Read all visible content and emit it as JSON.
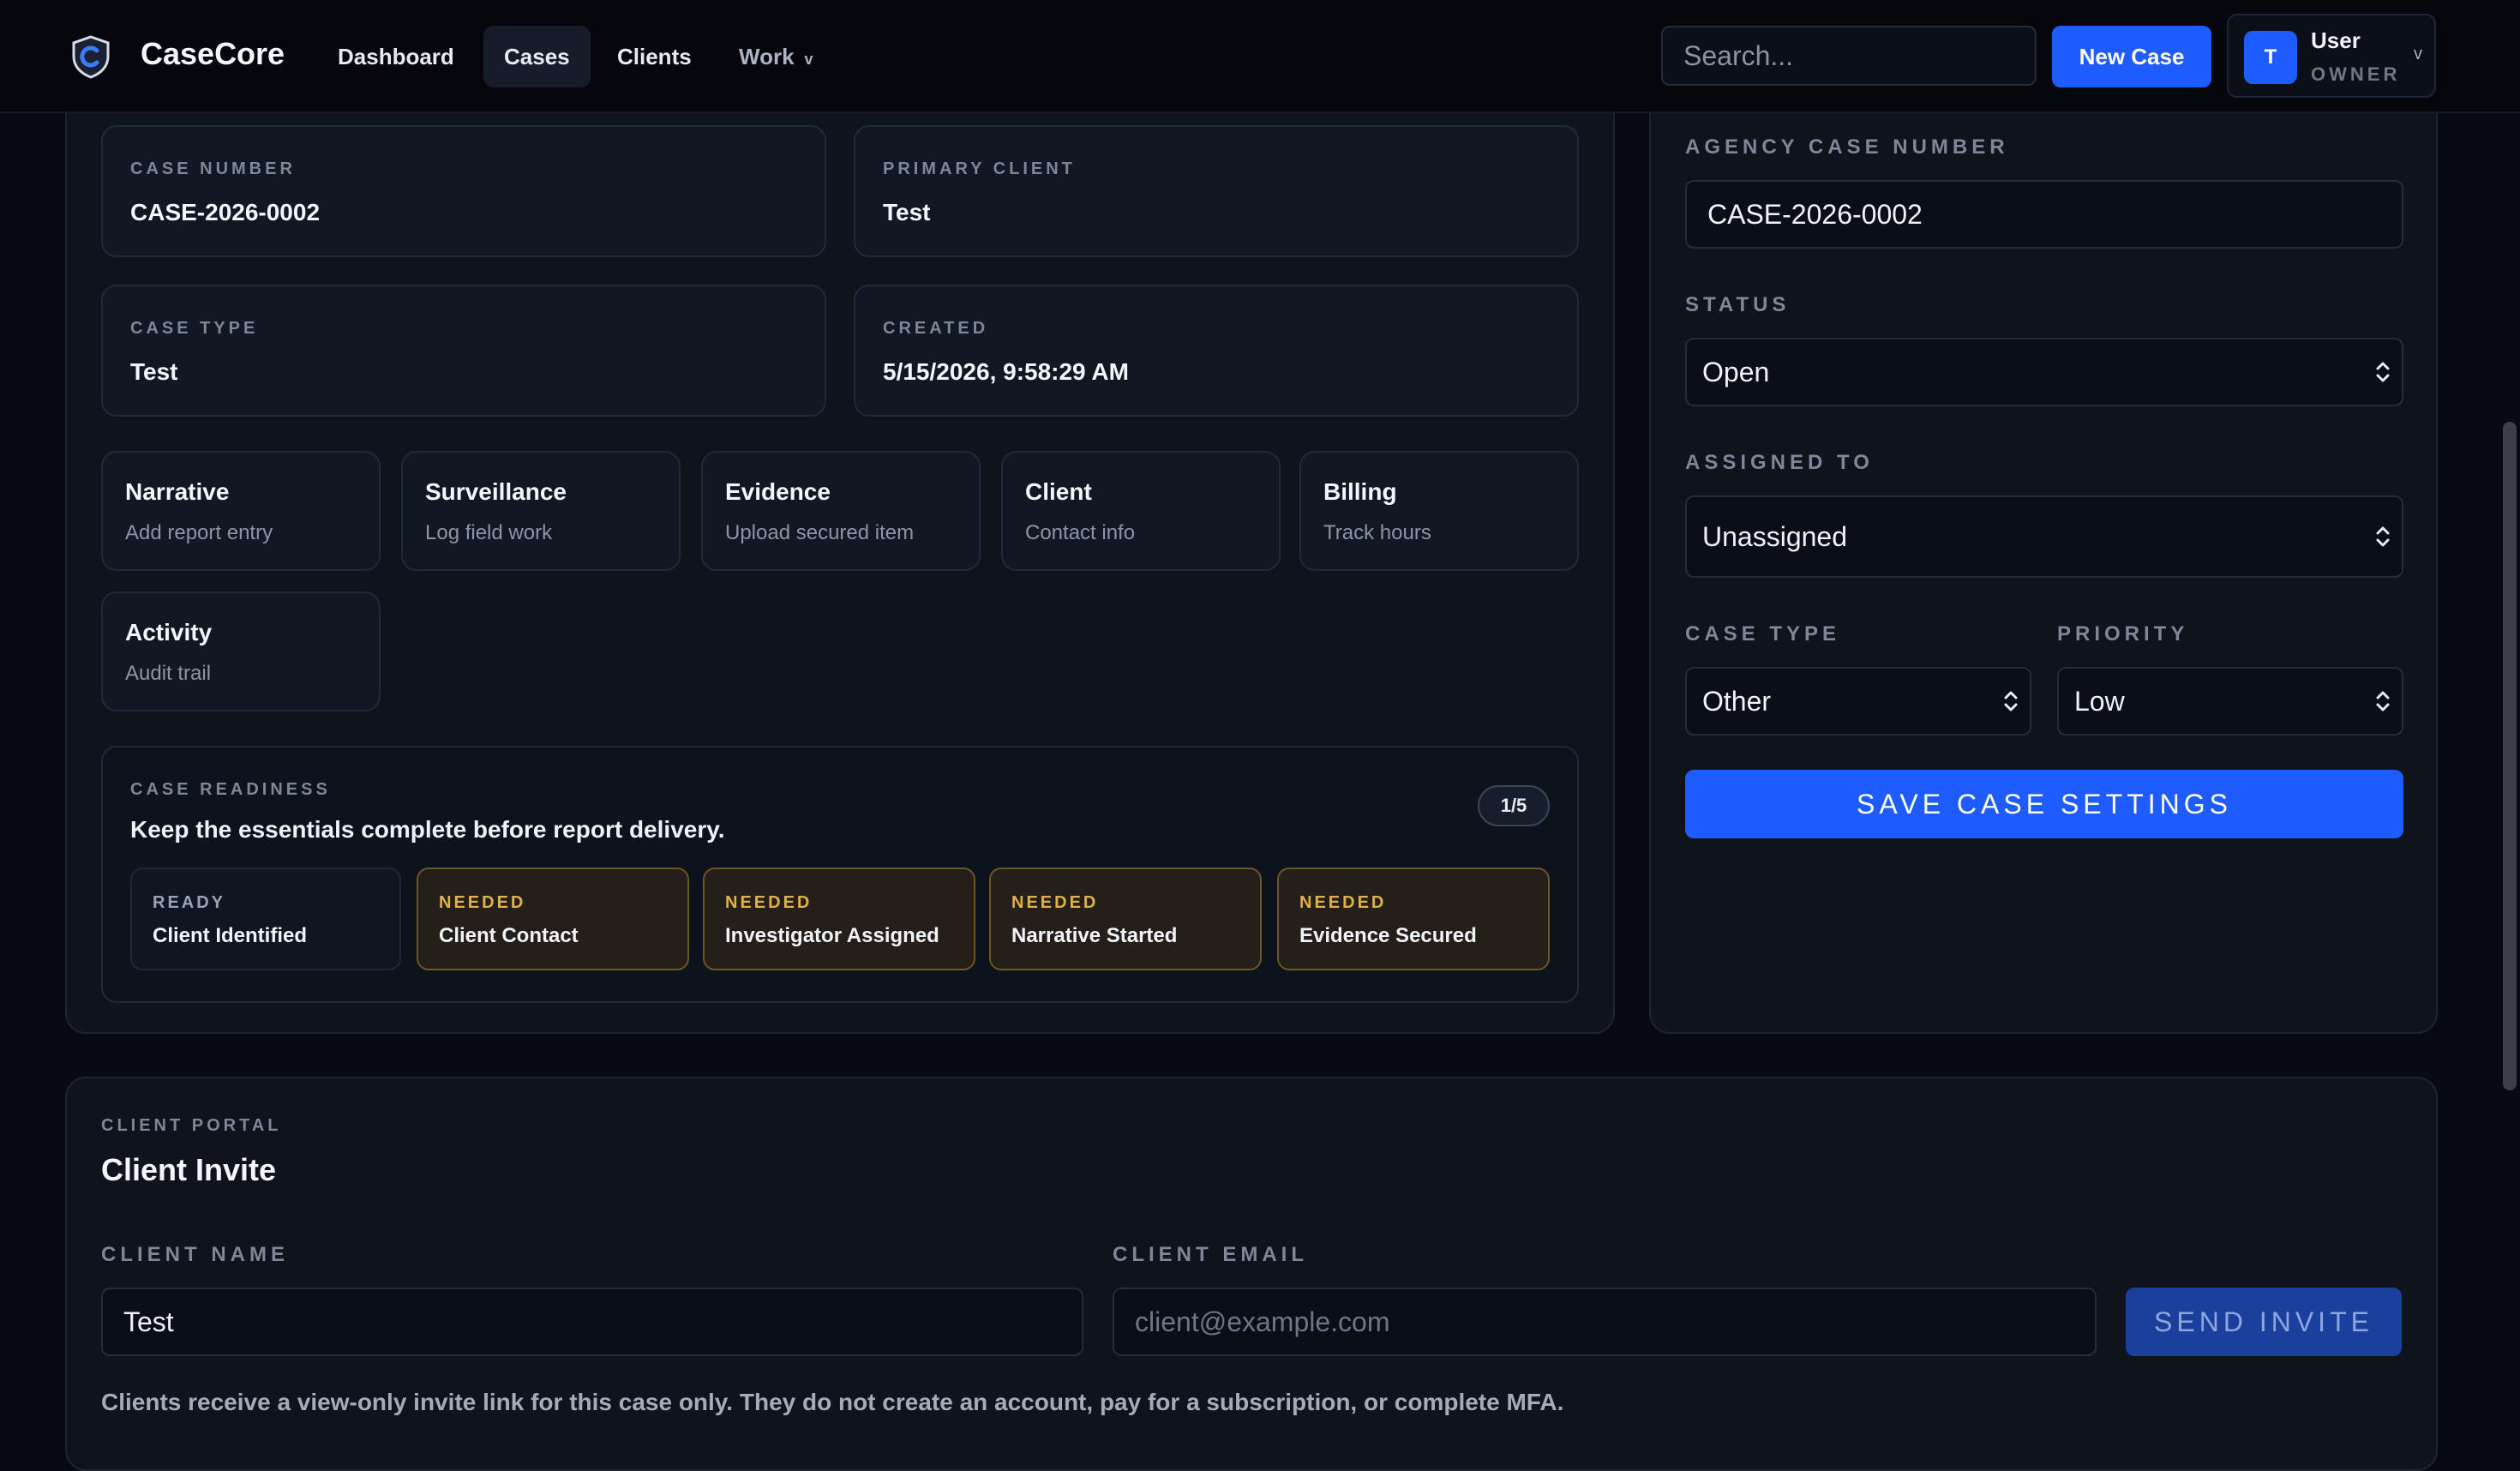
{
  "header": {
    "brand": "CaseCore",
    "nav": [
      {
        "label": "Dashboard",
        "active": false
      },
      {
        "label": "Cases",
        "active": true
      },
      {
        "label": "Clients",
        "active": false
      },
      {
        "label": "Work",
        "active": false,
        "has_dropdown": true,
        "chevron": "v"
      }
    ],
    "search_placeholder": "Search...",
    "new_case_label": "New Case",
    "user": {
      "avatar_initial": "T",
      "name": "User",
      "role": "OWNER",
      "chevron": "v"
    }
  },
  "case_info": [
    {
      "label": "CASE NUMBER",
      "value": "CASE-2026-0002"
    },
    {
      "label": "PRIMARY CLIENT",
      "value": "Test"
    },
    {
      "label": "CASE TYPE",
      "value": "Test"
    },
    {
      "label": "CREATED",
      "value": "5/15/2026, 9:58:29 AM"
    }
  ],
  "quick_actions": [
    {
      "title": "Narrative",
      "subtitle": "Add report entry"
    },
    {
      "title": "Surveillance",
      "subtitle": "Log field work"
    },
    {
      "title": "Evidence",
      "subtitle": "Upload secured item"
    },
    {
      "title": "Client",
      "subtitle": "Contact info"
    },
    {
      "title": "Billing",
      "subtitle": "Track hours"
    },
    {
      "title": "Activity",
      "subtitle": "Audit trail"
    }
  ],
  "readiness": {
    "eyebrow": "CASE READINESS",
    "title": "Keep the essentials complete before report delivery.",
    "count": "1/5",
    "items": [
      {
        "status": "READY",
        "label": "Client Identified"
      },
      {
        "status": "NEEDED",
        "label": "Client Contact"
      },
      {
        "status": "NEEDED",
        "label": "Investigator Assigned"
      },
      {
        "status": "NEEDED",
        "label": "Narrative Started"
      },
      {
        "status": "NEEDED",
        "label": "Evidence Secured"
      }
    ]
  },
  "settings": {
    "agency_case_number_label": "AGENCY CASE NUMBER",
    "agency_case_number_value": "CASE-2026-0002",
    "status_label": "STATUS",
    "status_value": "Open",
    "assigned_label": "ASSIGNED TO",
    "assigned_value": "Unassigned",
    "case_type_label": "CASE TYPE",
    "case_type_value": "Other",
    "priority_label": "PRIORITY",
    "priority_value": "Low",
    "save_label": "SAVE CASE SETTINGS"
  },
  "client_portal": {
    "eyebrow": "CLIENT PORTAL",
    "title": "Client Invite",
    "name_label": "CLIENT NAME",
    "name_value": "Test",
    "email_label": "CLIENT EMAIL",
    "email_placeholder": "client@example.com",
    "send_label": "SEND INVITE",
    "note": "Clients receive a view-only invite link for this case only. They do not create an account, pay for a subscription, or complete MFA."
  },
  "colors": {
    "accent": "#1e5cff",
    "background": "#070a10",
    "panel": "#0e131c",
    "needed_border": "#6e5622",
    "needed_text": "#e0b04a"
  },
  "icons": [
    "shield-logo-icon",
    "chevron-down-icon",
    "select-updown-icon"
  ]
}
